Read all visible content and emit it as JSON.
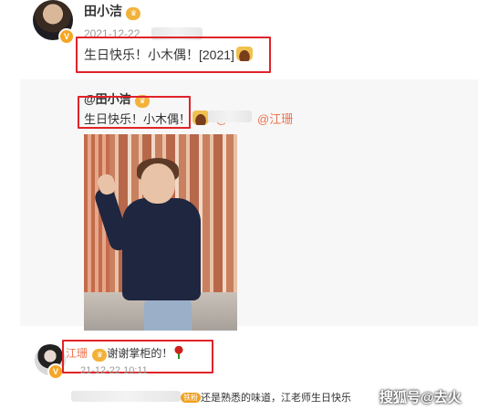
{
  "post": {
    "username": "田小洁",
    "date": "2021-12-22",
    "text": "生日快乐！小木偶！[2021]"
  },
  "repost": {
    "username": "@田小洁",
    "text": "生日快乐！小木偶！",
    "mention": "@江珊"
  },
  "reply": {
    "username": "江珊",
    "text": "谢谢掌柜的！",
    "date": "21-12-22 10:11"
  },
  "comment": {
    "fan_badge": "铁粉",
    "text": "还是熟悉的味道，江老师生日快乐"
  },
  "watermark": "搜狐号@去火"
}
